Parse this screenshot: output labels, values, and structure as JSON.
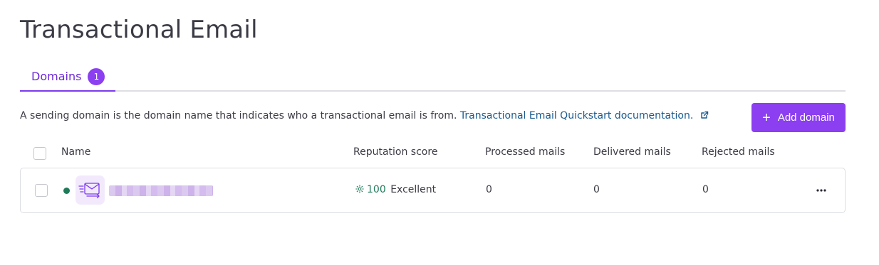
{
  "page": {
    "title": "Transactional Email"
  },
  "tabs": [
    {
      "label": "Domains",
      "count": "1",
      "active": true
    }
  ],
  "description": {
    "text": "A sending domain is the domain name that indicates who a transactional email is from.",
    "link_text": "Transactional Email Quickstart documentation."
  },
  "toolbar": {
    "add_domain_label": "Add domain"
  },
  "table": {
    "columns": {
      "name": "Name",
      "reputation": "Reputation score",
      "processed": "Processed mails",
      "delivered": "Delivered mails",
      "rejected": "Rejected mails"
    },
    "rows": [
      {
        "status": "active",
        "reputation_score": "100",
        "reputation_label": "Excellent",
        "processed": "0",
        "delivered": "0",
        "rejected": "0"
      }
    ]
  },
  "colors": {
    "accent": "#8b3ff0",
    "link": "#1a5a8f",
    "success": "#1f7a5a"
  },
  "icons": {
    "tab_badge": "count-badge",
    "external": "external-link-icon",
    "add": "plus-icon",
    "domain": "mail-send-icon",
    "reputation": "sun-icon",
    "more": "more-horizontal-icon"
  }
}
